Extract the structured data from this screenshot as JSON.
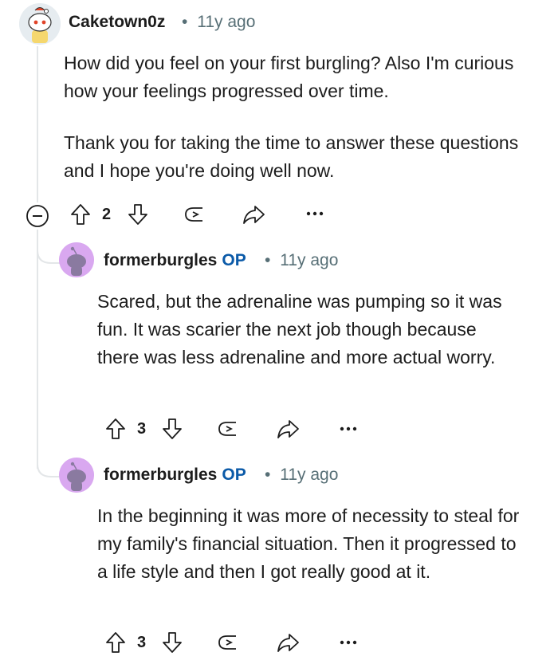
{
  "comments": [
    {
      "username": "Caketown0z",
      "separator": "•",
      "time": "11y ago",
      "paragraphs": [
        "How did you feel on your first burgling? Also I'm curious how your feelings progressed over time.",
        "Thank you for taking the time to answer these questions and I hope you're doing well now."
      ],
      "votes": "2"
    },
    {
      "username": "formerburgles",
      "op_badge": "OP",
      "separator": "•",
      "time": "11y ago",
      "paragraphs": [
        "Scared, but the adrenaline was pumping so it was fun. It was scarier the next job though because there was less adrenaline and more actual worry."
      ],
      "votes": "3"
    },
    {
      "username": "formerburgles",
      "op_badge": "OP",
      "separator": "•",
      "time": "11y ago",
      "paragraphs": [
        "In the beginning it was more of necessity to steal for my family's financial situation. Then it progressed to a life style and then I got really good at it."
      ],
      "votes": "3"
    }
  ],
  "colors": {
    "text": "#1c1c1c",
    "meta": "#576f76",
    "op": "#0b5aa8",
    "thread_line": "#e3e6e8",
    "avatar_purple": "#d9a8f0"
  }
}
